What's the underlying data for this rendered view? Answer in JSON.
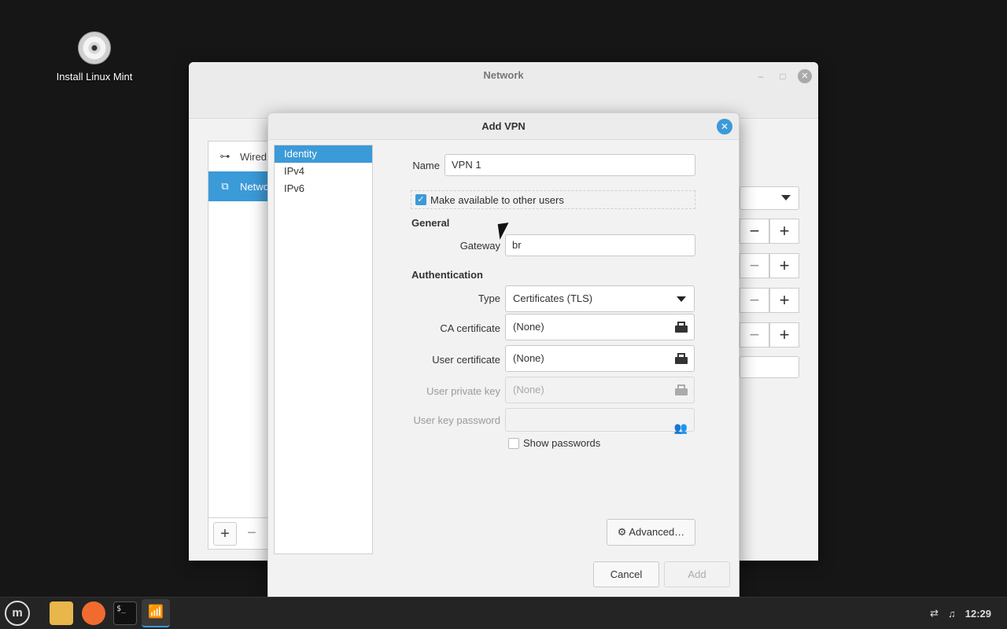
{
  "desktop": {
    "icon_label": "Install Linux Mint"
  },
  "network_window": {
    "title": "Network",
    "sidebar": [
      {
        "label": "Wired",
        "icon": "wired-network-icon"
      },
      {
        "label": "Netwo",
        "icon": "vpn-network-icon"
      }
    ]
  },
  "dialog": {
    "title": "Add VPN",
    "nav": [
      "Identity",
      "IPv4",
      "IPv6"
    ],
    "name_label": "Name",
    "name_value": "VPN 1",
    "make_available_label": "Make available to other users",
    "general_heading": "General",
    "gateway_label": "Gateway",
    "gateway_value": "br",
    "auth_heading": "Authentication",
    "type_label": "Type",
    "type_value": "Certificates (TLS)",
    "ca_cert_label": "CA certificate",
    "ca_cert_value": "(None)",
    "user_cert_label": "User certificate",
    "user_cert_value": "(None)",
    "user_key_label": "User private key",
    "user_key_value": "(None)",
    "user_key_password_label": "User key password",
    "show_passwords_label": "Show passwords",
    "advanced_label": "Advanced…",
    "cancel_label": "Cancel",
    "add_label": "Add"
  },
  "taskbar": {
    "clock": "12:29"
  },
  "colors": {
    "accent": "#3b9ad8"
  }
}
